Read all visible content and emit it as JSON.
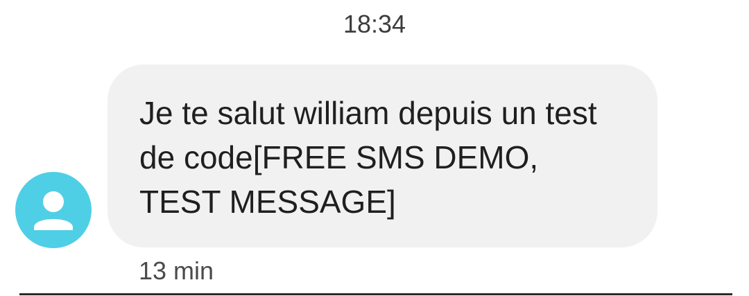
{
  "conversation": {
    "date_header": "18:34",
    "message": {
      "text": "Je te salut william depuis un test de code[FREE SMS DEMO, TEST MESSAGE]",
      "relative_time": "13 min",
      "direction": "incoming"
    },
    "sender": {
      "avatar_icon": "person-icon",
      "avatar_color": "#4fcfe6"
    }
  },
  "colors": {
    "bubble_background": "#f1f1f1",
    "text": "#1f1f1f",
    "meta_text": "#4a4a4a"
  }
}
